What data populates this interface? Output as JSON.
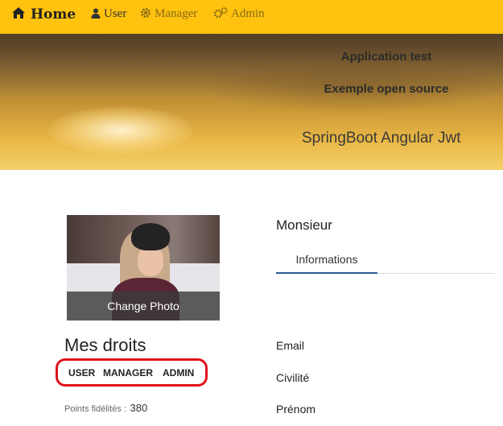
{
  "navbar": {
    "brand": "Home",
    "links": {
      "user": "User",
      "manager": "Manager",
      "admin": "Admin"
    },
    "background": "#ffc20e"
  },
  "hero": {
    "title": "Application test",
    "subtitle": "Exemple open source",
    "tagline": "SpringBoot Angular Jwt"
  },
  "profile": {
    "change_photo": "Change Photo",
    "rights_title": "Mes droits",
    "roles": [
      "USER",
      "MANAGER",
      "ADMIN"
    ],
    "points_label": "Points fidélités :",
    "points_value": "380"
  },
  "details": {
    "salutation": "Monsieur",
    "tab_label": "Informations",
    "fields": [
      "Email",
      "Civilité",
      "Prénom"
    ]
  },
  "colors": {
    "accent": "#ffc20e",
    "tab_underline": "#2a5a93",
    "highlight": "#e0121c"
  }
}
